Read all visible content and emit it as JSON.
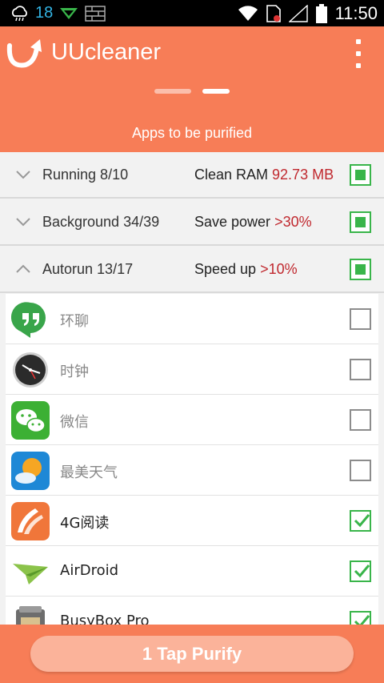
{
  "status_bar": {
    "temperature": "18",
    "time": "11:50"
  },
  "header": {
    "app_title": "UUcleaner",
    "subtitle": "Apps to be purified"
  },
  "categories": [
    {
      "label": "Running 8/10",
      "info_label": "Clean RAM ",
      "info_value": "92.73 MB",
      "expanded": false,
      "checked": true
    },
    {
      "label": "Background 34/39",
      "info_label": "Save power ",
      "info_value": ">30%",
      "expanded": false,
      "checked": true
    },
    {
      "label": "Autorun 13/17",
      "info_label": "Speed up ",
      "info_value": ">10%",
      "expanded": true,
      "checked": true
    }
  ],
  "apps": [
    {
      "name": "环聊",
      "icon": "hangouts-icon",
      "checked": false
    },
    {
      "name": "时钟",
      "icon": "clock-icon",
      "checked": false
    },
    {
      "name": "微信",
      "icon": "wechat-icon",
      "checked": false
    },
    {
      "name": "最美天气",
      "icon": "weather-icon",
      "checked": false
    },
    {
      "name": "4G阅读",
      "icon": "reader-icon",
      "checked": true
    },
    {
      "name": "AirDroid",
      "icon": "airdroid-icon",
      "checked": true
    },
    {
      "name": "BusyBox Pro",
      "icon": "busybox-icon",
      "checked": true
    }
  ],
  "purify_button": {
    "label": "1 Tap Purify"
  },
  "colors": {
    "accent": "#f77d57",
    "check_green": "#39b54a",
    "value_red": "#c0282e"
  }
}
